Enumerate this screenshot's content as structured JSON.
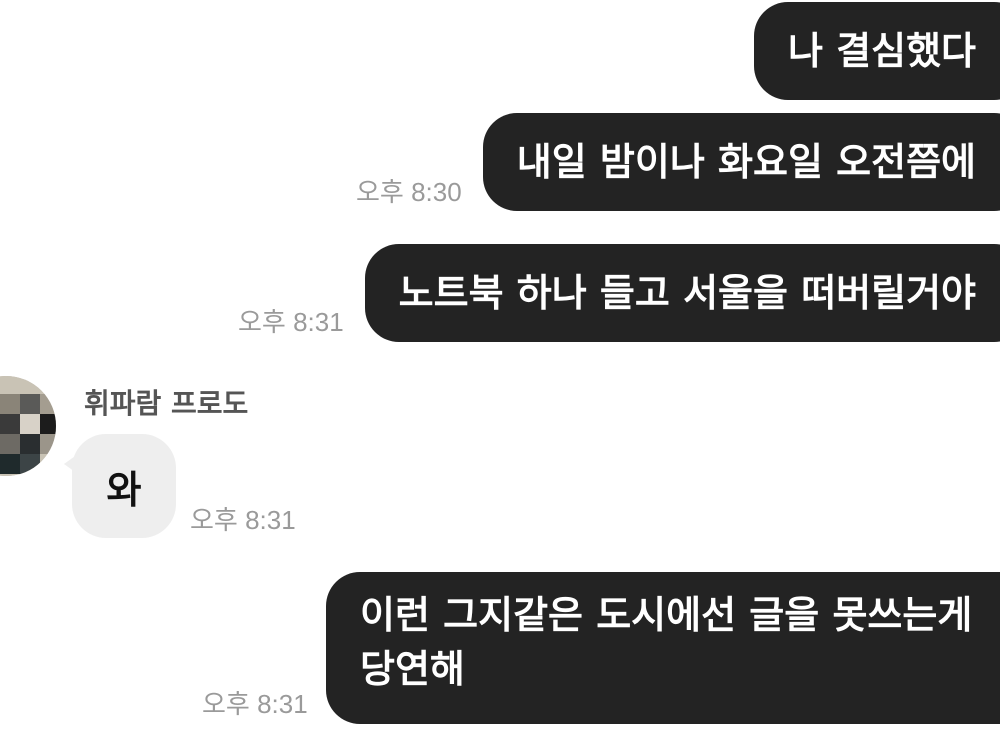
{
  "messages": [
    {
      "id": "m1",
      "from": "me",
      "text": "나 결심했다",
      "time": ""
    },
    {
      "id": "m2",
      "from": "me",
      "text": "내일 밤이나 화요일 오전쯤에",
      "time": "오후 8:30"
    },
    {
      "id": "m3",
      "from": "me",
      "text": "노트북 하나 들고 서울을 떠버릴거야",
      "time": "오후 8:31"
    },
    {
      "id": "m4",
      "from": "friend",
      "sender": "휘파람 프로도",
      "text": "와",
      "time": "오후 8:31"
    },
    {
      "id": "m5",
      "from": "me",
      "text_line1": "이런 그지같은 도시에선 글을 못쓰는게",
      "text_line2": "당연해",
      "time": "오후 8:31"
    }
  ],
  "colors": {
    "outgoing_bubble": "#232323",
    "incoming_bubble": "#eeeeee",
    "timestamp": "#9a9a9a",
    "sender_name": "#555555"
  },
  "icons": {
    "avatar": "blurred-profile-photo"
  }
}
